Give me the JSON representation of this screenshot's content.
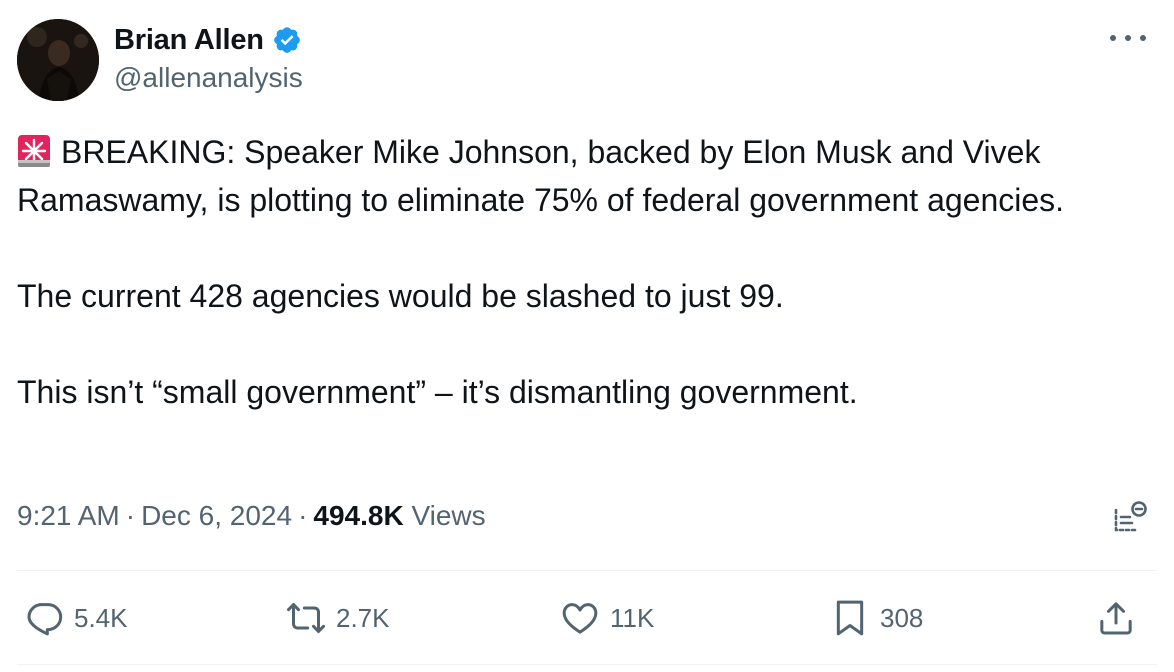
{
  "author": {
    "display_name": "Brian Allen",
    "handle": "@allenanalysis",
    "verified": true,
    "verified_color": "#1d9bf0"
  },
  "tweet": {
    "paragraphs": [
      "BREAKING: Speaker Mike Johnson, backed by Elon Musk and Vivek Ramaswamy, is plotting to eliminate 75% of federal government agencies.",
      "The current 428 agencies would be slashed to just 99.",
      "This isn’t “small government” – it’s dismantling government."
    ],
    "leading_icon": "rotating-light-siren-icon"
  },
  "meta": {
    "time": "9:21 AM",
    "separator": "·",
    "date": "Dec 6, 2024",
    "views_count": "494.8K",
    "views_label": "Views"
  },
  "actions": {
    "replies": "5.4K",
    "reposts": "2.7K",
    "likes": "11K",
    "bookmarks": "308"
  },
  "colors": {
    "text_primary": "#0f1419",
    "text_secondary": "#536471",
    "divider": "#eff3f4",
    "siren_red": "#e0245e"
  }
}
